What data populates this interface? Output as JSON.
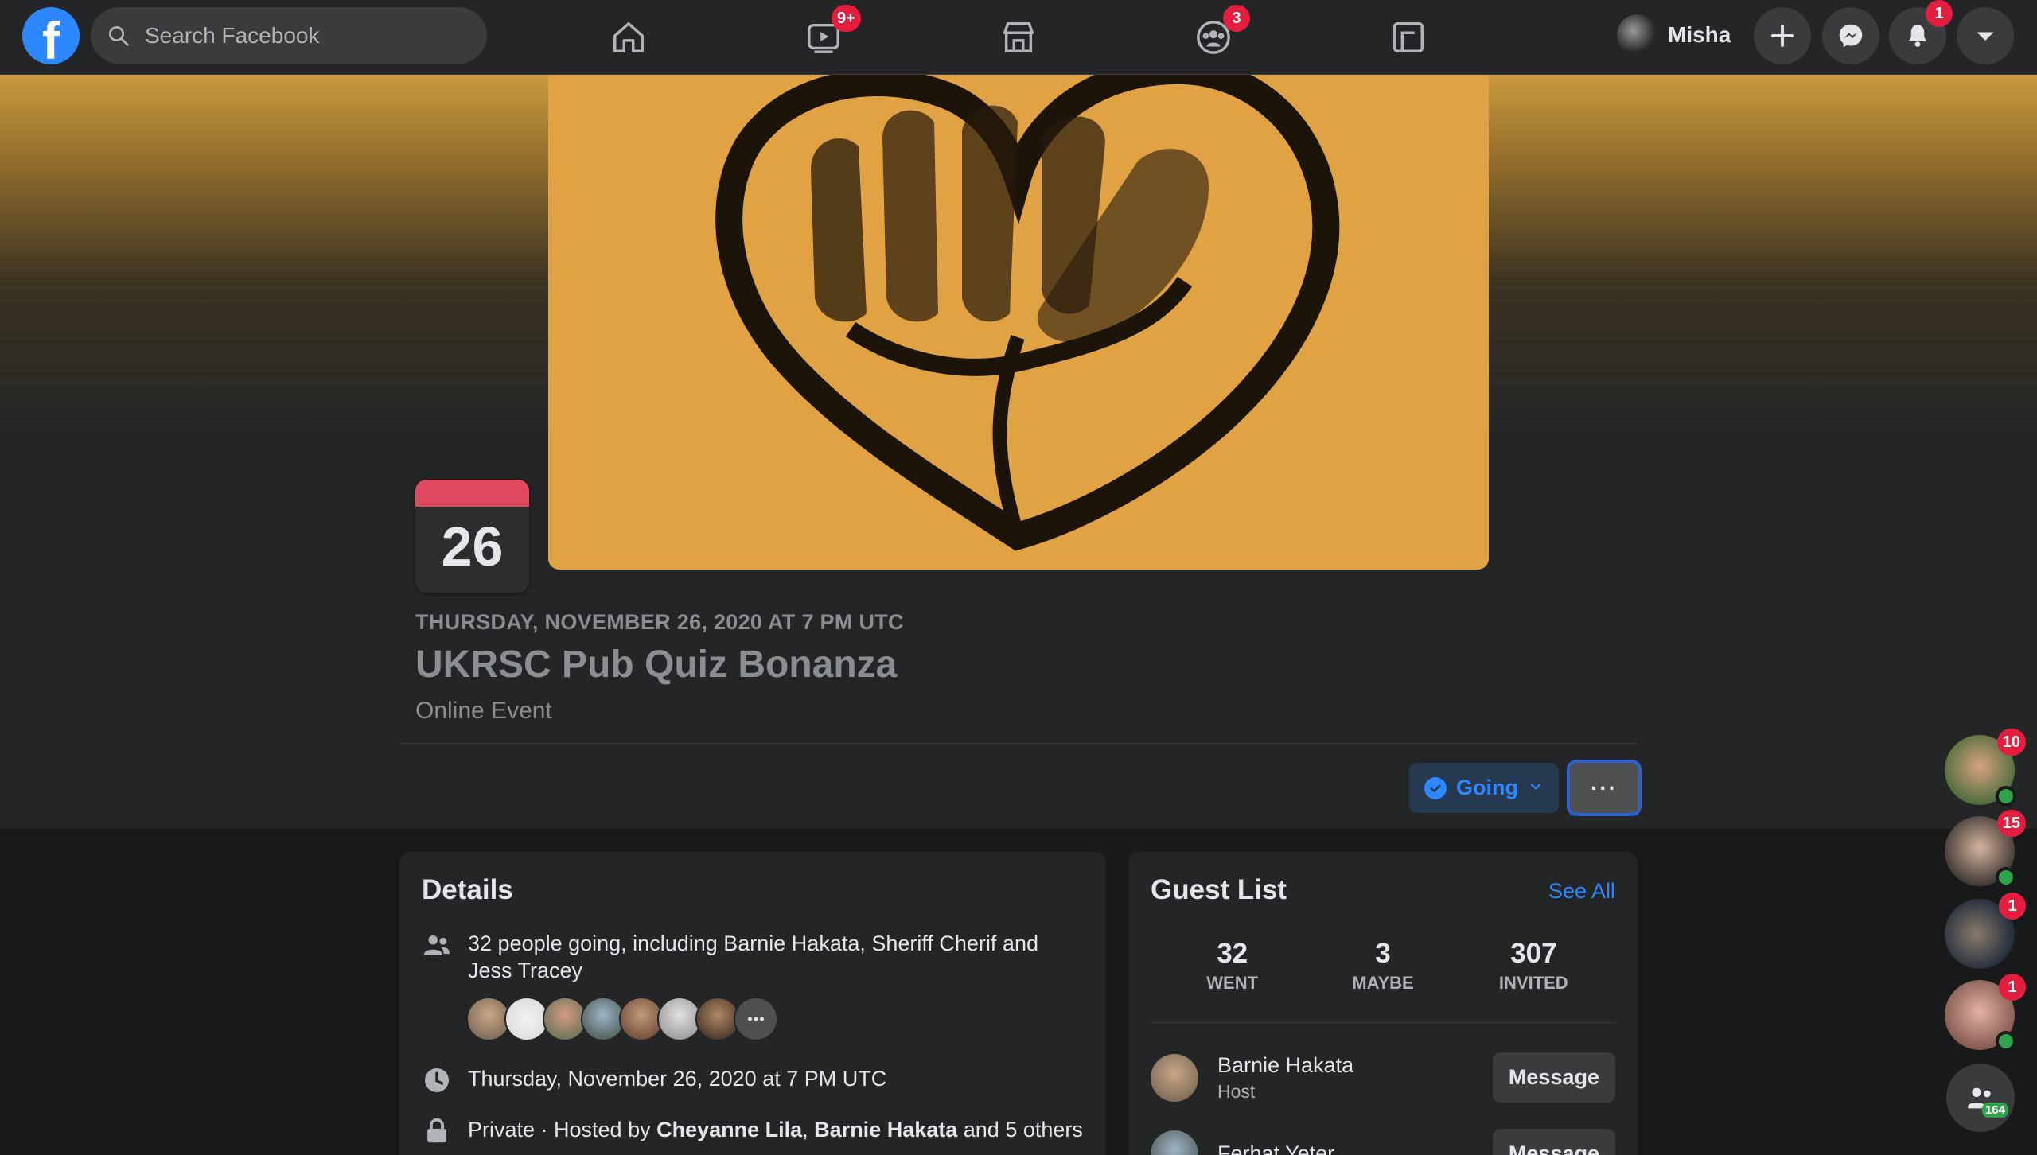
{
  "topbar": {
    "search_placeholder": "Search Facebook",
    "watch_badge": "9+",
    "groups_badge": "3",
    "profile_name": "Misha",
    "notifications_badge": "1"
  },
  "event": {
    "day": "26",
    "date_line": "THURSDAY, NOVEMBER 26, 2020 AT 7 PM UTC",
    "title": "UKRSC Pub Quiz Bonanza",
    "type": "Online Event",
    "going_label": "Going",
    "more_label": "···"
  },
  "details": {
    "title": "Details",
    "people_text": "32 people going, including Barnie Hakata, Sheriff Cherif and Jess Tracey",
    "datetime_text": "Thursday, November 26, 2020 at 7 PM UTC",
    "privacy_prefix": "Private · Hosted by ",
    "host1": "Cheyanne Lila",
    "sep": ", ",
    "host2": "Barnie Hakata",
    "privacy_suffix": " and 5 others"
  },
  "guest_list": {
    "title": "Guest List",
    "see_all": "See All",
    "stats": [
      {
        "num": "32",
        "label": "WENT"
      },
      {
        "num": "3",
        "label": "MAYBE"
      },
      {
        "num": "307",
        "label": "INVITED"
      }
    ],
    "guests": [
      {
        "name": "Barnie Hakata",
        "role": "Host",
        "action": "Message"
      },
      {
        "name": "Ferhat Yeter",
        "role": "",
        "action": "Message"
      }
    ]
  },
  "chatheads": {
    "badges": [
      "10",
      "15",
      "1",
      "1"
    ],
    "group_count": "164"
  },
  "colors": {
    "accent": "#2d88ff",
    "badge": "#e41e3f",
    "calendar_top": "#e0495f",
    "online": "#31a24c"
  }
}
